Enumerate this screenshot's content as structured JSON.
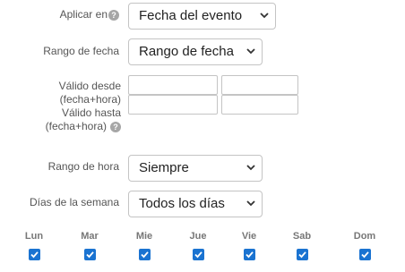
{
  "apply_on": {
    "label": "Aplicar en",
    "help": "?",
    "value": "Fecha del evento"
  },
  "date_range": {
    "label": "Rango de fecha",
    "value": "Rango de fecha"
  },
  "valid_from": {
    "label_line1": "Válido desde",
    "label_line2": "(fecha+hora)"
  },
  "valid_to": {
    "label_line1": "Válido hasta",
    "label_line2": "(fecha+hora)",
    "help": "?"
  },
  "time_range": {
    "label": "Rango de hora",
    "value": "Siempre"
  },
  "weekdays": {
    "label": "Días de la semana",
    "value": "Todos los días"
  },
  "days": [
    {
      "label": "Lun",
      "checked": true
    },
    {
      "label": "Mar",
      "checked": true
    },
    {
      "label": "Mie",
      "checked": true
    },
    {
      "label": "Jue",
      "checked": true
    },
    {
      "label": "Vie",
      "checked": true
    },
    {
      "label": "Sab",
      "checked": true
    },
    {
      "label": "Dom",
      "checked": true
    }
  ],
  "colors": {
    "checkbox": "#1a73d1",
    "help_icon": "#a6a6a6"
  }
}
